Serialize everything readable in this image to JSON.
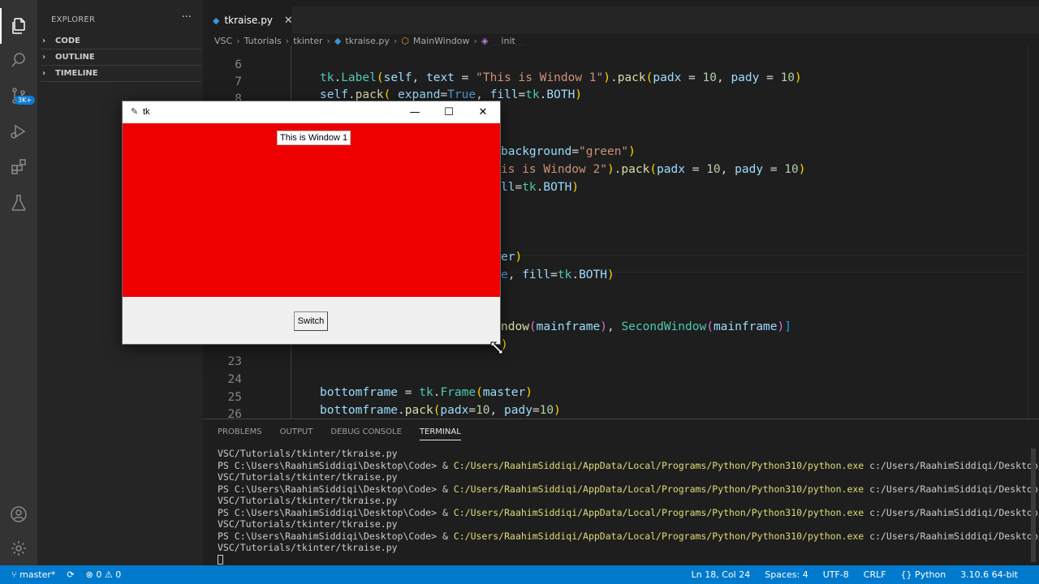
{
  "activity": {
    "items": [
      "files-icon",
      "search-icon",
      "source-control-icon",
      "run-debug-icon",
      "extensions-icon",
      "testing-icon",
      "accounts-icon",
      "settings-gear-icon"
    ],
    "scm_badge": "3K+"
  },
  "sidebar": {
    "title": "EXPLORER",
    "more": "···",
    "sections": [
      "CODE",
      "OUTLINE",
      "TIMELINE"
    ]
  },
  "editor": {
    "tab_label": "tkraise.py",
    "tab_close": "✕",
    "breadcrumb": [
      "VSC",
      "Tutorials",
      "tkinter",
      "tkraise.py",
      "MainWindow",
      "__init__"
    ],
    "line_numbers": [
      "6",
      "7",
      "8",
      "23",
      "24",
      "25",
      "26"
    ]
  },
  "tk_window": {
    "title": "tk",
    "label_text": "This is Window 1",
    "button_text": "Switch",
    "minimize": "—",
    "maximize": "☐",
    "close": "✕",
    "frame_color": "#ee0000"
  },
  "panel": {
    "tabs": [
      "PROBLEMS",
      "OUTPUT",
      "DEBUG CONSOLE",
      "TERMINAL"
    ],
    "active_tab": "TERMINAL",
    "terminal_lines": [
      {
        "prompt": "",
        "cmd": "",
        "rest": "VSC/Tutorials/tkinter/tkraise.py"
      },
      {
        "prompt": "PS C:\\Users\\RaahimSiddiqi\\Desktop\\Code> & ",
        "cmd": "C:/Users/RaahimSiddiqi/AppData/Local/Programs/Python/Python310/python.exe",
        "rest": " c:/Users/RaahimSiddiqi/Desktop/Code/"
      },
      {
        "prompt": "",
        "cmd": "",
        "rest": "VSC/Tutorials/tkinter/tkraise.py"
      },
      {
        "prompt": "PS C:\\Users\\RaahimSiddiqi\\Desktop\\Code> & ",
        "cmd": "C:/Users/RaahimSiddiqi/AppData/Local/Programs/Python/Python310/python.exe",
        "rest": " c:/Users/RaahimSiddiqi/Desktop/Code/"
      },
      {
        "prompt": "",
        "cmd": "",
        "rest": "VSC/Tutorials/tkinter/tkraise.py"
      },
      {
        "prompt": "PS C:\\Users\\RaahimSiddiqi\\Desktop\\Code> & ",
        "cmd": "C:/Users/RaahimSiddiqi/AppData/Local/Programs/Python/Python310/python.exe",
        "rest": " c:/Users/RaahimSiddiqi/Desktop/Code/"
      },
      {
        "prompt": "",
        "cmd": "",
        "rest": "VSC/Tutorials/tkinter/tkraise.py"
      },
      {
        "prompt": "PS C:\\Users\\RaahimSiddiqi\\Desktop\\Code> & ",
        "cmd": "C:/Users/RaahimSiddiqi/AppData/Local/Programs/Python/Python310/python.exe",
        "rest": " c:/Users/RaahimSiddiqi/Desktop/Code/"
      },
      {
        "prompt": "",
        "cmd": "",
        "rest": "VSC/Tutorials/tkinter/tkraise.py"
      }
    ]
  },
  "status": {
    "branch": "master*",
    "sync": "⟳",
    "errors": "⊗ 0",
    "warnings": "⚠ 0",
    "position": "Ln 18, Col 24",
    "spaces": "Spaces: 4",
    "encoding": "UTF-8",
    "eol": "CRLF",
    "language": "Python",
    "interpreter": "3.10.6 64-bit"
  }
}
